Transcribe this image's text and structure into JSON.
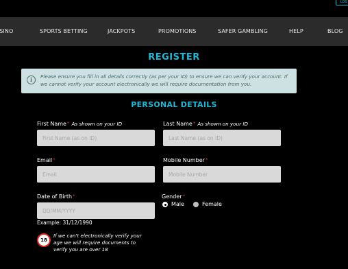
{
  "header": {
    "login_label": "LOG"
  },
  "nav": {
    "items": [
      {
        "label": "CASINO"
      },
      {
        "label": "SPORTS BETTING"
      },
      {
        "label": "JACKPOTS"
      },
      {
        "label": "PROMOTIONS"
      },
      {
        "label": "SAFER GAMBLING"
      },
      {
        "label": "HELP"
      },
      {
        "label": "BLOG"
      }
    ]
  },
  "page": {
    "title": "REGISTER",
    "section_title": "PERSONAL DETAILS"
  },
  "info": {
    "icon": "info-icon",
    "text": "Please ensure you fill in all details correctly (as per your ID) to ensure we can verify your account. If we cannot verify your account electronically we will require documentation from you."
  },
  "form": {
    "required_mark": "*",
    "first_name": {
      "label": "First Name",
      "hint": "As shown on your ID",
      "placeholder": "First Name (as on ID)"
    },
    "last_name": {
      "label": "Last Name",
      "hint": "As shown on your ID",
      "placeholder": "Last Name (as on ID)"
    },
    "email": {
      "label": "Email",
      "placeholder": "Email"
    },
    "mobile": {
      "label": "Mobile Number",
      "placeholder": "Mobile Number"
    },
    "dob": {
      "label": "Date of Birth",
      "placeholder": "DD/MM/YYYY",
      "example": "Example: 31/12/1990"
    },
    "gender": {
      "label": "Gender",
      "options": [
        "Male",
        "Female"
      ],
      "selected": "Male"
    }
  },
  "age_notice": {
    "badge": "18",
    "text": "If we can't electronically verify your age we will require documents to verify you are over 18"
  },
  "colors": {
    "accent": "#1fb8d6",
    "required": "#e0322f",
    "nav_bg": "#2b2b2b",
    "info_bg": "#cde0e2"
  }
}
